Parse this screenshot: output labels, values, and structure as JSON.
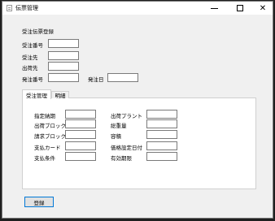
{
  "window": {
    "title": "伝票管理",
    "minimize_icon": "minimize-icon",
    "maximize_icon": "maximize-icon",
    "close_icon": "close-icon"
  },
  "header": {
    "section_title": "受注伝票登録"
  },
  "form": {
    "order_number_label": "受注番号",
    "order_number_value": "",
    "customer_label": "受注先",
    "customer_value": "",
    "ship_to_label": "出荷先",
    "ship_to_value": "",
    "po_number_label": "発注番号",
    "po_number_value": "",
    "po_date_label": "発注日",
    "po_date_value": ""
  },
  "tabs": [
    {
      "label": "受注管理",
      "active": true
    },
    {
      "label": "明細",
      "active": false
    }
  ],
  "order_mgmt": {
    "due_date_label": "指定納期",
    "due_date_value": "",
    "ship_block_label": "出荷ブロック",
    "ship_block_value": "",
    "billing_block_label": "請求ブロック",
    "billing_block_value": "",
    "payment_card_label": "支払カード",
    "payment_card_value": "",
    "payment_terms_label": "支払条件",
    "payment_terms_value": "",
    "shipping_plant_label": "出荷プラント",
    "shipping_plant_value": "",
    "total_weight_label": "総重量",
    "total_weight_value": "",
    "volume_label": "容積",
    "volume_value": "",
    "pricing_date_label": "価格設定日付",
    "pricing_date_value": "",
    "valid_until_label": "有効期限",
    "valid_until_value": ""
  },
  "footer": {
    "register_label": "登録"
  }
}
